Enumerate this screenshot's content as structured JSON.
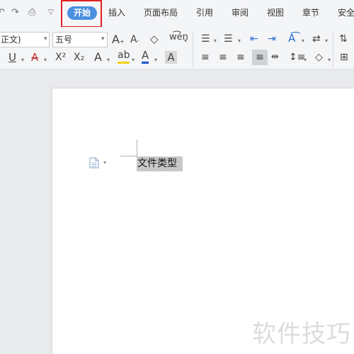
{
  "quick_access": {
    "undo_icon": "undo-icon",
    "redo_icon": "redo-icon",
    "print_icon": "print-icon",
    "more_icon": "chevron-down-icon"
  },
  "tabs": [
    {
      "label": "开始",
      "active": true
    },
    {
      "label": "插入"
    },
    {
      "label": "页面布局"
    },
    {
      "label": "引用"
    },
    {
      "label": "审阅"
    },
    {
      "label": "视图"
    },
    {
      "label": "章节"
    },
    {
      "label": "安全"
    }
  ],
  "ribbon": {
    "font_name": "正文)",
    "font_size": "五号",
    "grow_font": "A⁺",
    "shrink_font": "A⁻",
    "clear_format": "◇",
    "phonetic": "wén",
    "underline": "U",
    "strikethrough": "A",
    "superscript": "X²",
    "subscript": "X₂",
    "text_effect": "A",
    "highlight": "ab",
    "font_color": "A",
    "char_shading": "A"
  },
  "document": {
    "selected_text": "文件类型"
  },
  "watermark": "软件技巧",
  "colors": {
    "active_tab": "#4a8fe0",
    "highlight_box": "#e02020",
    "selection": "#c8c8c8",
    "highlight_yellow": "#f5d21a",
    "font_color_red": "#e02020",
    "font_color_blue": "#2255cc"
  }
}
